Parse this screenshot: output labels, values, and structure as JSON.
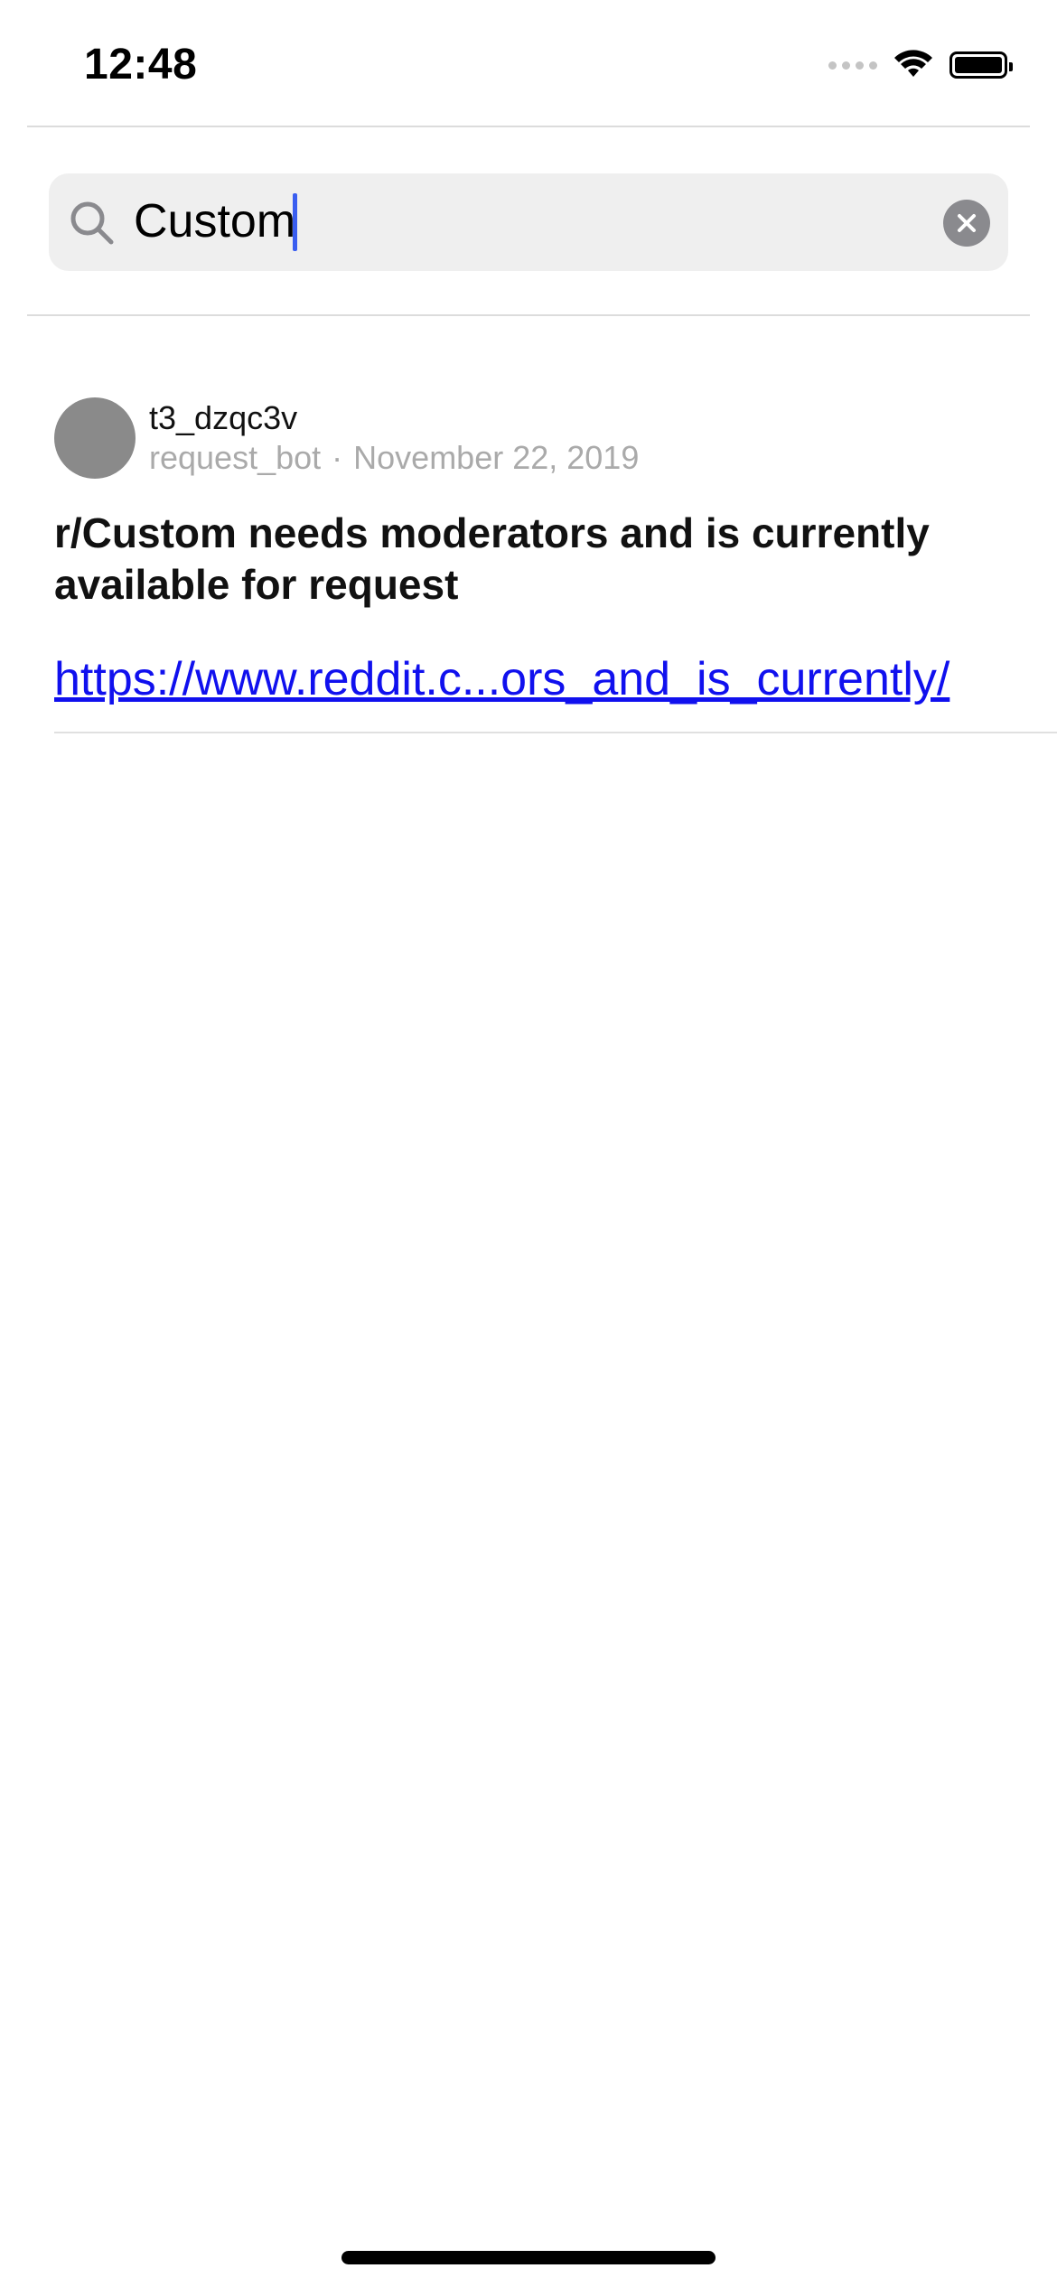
{
  "status_bar": {
    "time": "12:48",
    "icons": [
      "signal-icon",
      "wifi-icon",
      "battery-icon"
    ]
  },
  "search": {
    "value": "Custom",
    "icon": "search-icon",
    "clear_icon": "clear-icon",
    "caret_color": "#3a5ef0"
  },
  "post": {
    "id": "t3_dzqc3v",
    "author": "request_bot",
    "separator": "·",
    "date": "November 22, 2019",
    "title": "r/Custom needs moderators and is currently available for request",
    "link": "https://www.reddit.c...ors_and_is_currently/",
    "link_color": "#1010ee"
  }
}
